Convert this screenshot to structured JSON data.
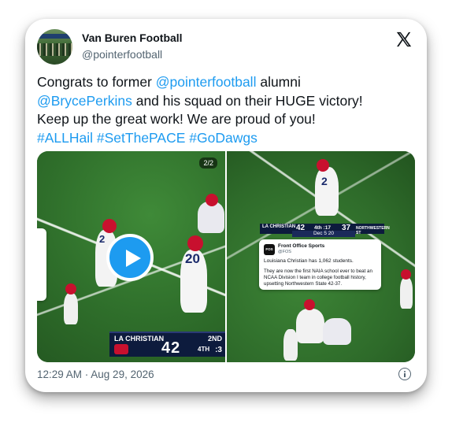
{
  "author": {
    "name": "Van Buren Football",
    "handle": "@pointerfootball"
  },
  "tweet": {
    "t1": "Congrats to former ",
    "mention1": "@pointerfootball",
    "t2": " alumni",
    "mention2": "@BrycePerkins",
    "t3": " and his squad on their HUGE victory!",
    "t4": "Keep up the great work! We are proud of you!",
    "tag1": "#ALLHail",
    "tag2": "#SetThePACE",
    "tag3": "#GoDawgs"
  },
  "media": {
    "counter": "2/2",
    "left": {
      "jersey": "20",
      "jersey2": "2",
      "scorebug": {
        "team": "LA CHRISTIAN",
        "score": "42",
        "quarter_label": "2ND",
        "quarter": "4TH",
        "clock": ":3"
      }
    },
    "right": {
      "jersey": "2",
      "scorebug": {
        "team_left": "LA CHRISTIAN",
        "score_left": "42",
        "clock": "4th :17",
        "score_right": "37",
        "team_right": "NORTHWESTERN ST",
        "sub": "Dec 5 20"
      },
      "overlay": {
        "logo": "FOS",
        "name": "Front Office Sports",
        "handle": "@FOS",
        "line1": "Louisiana Christian has 1,062 students.",
        "line2": "They are now the first NAIA school ever to beat an NCAA Division I team in college football history, upsetting Northwestern State 42-37."
      }
    }
  },
  "timestamp": "12:29 AM · Aug 29, 2026",
  "icons": {
    "x": "x-logo-icon",
    "play": "play-icon",
    "info": "info-icon"
  },
  "colors": {
    "link": "#1d9bf0",
    "text": "#0f1419",
    "muted": "#536471"
  }
}
